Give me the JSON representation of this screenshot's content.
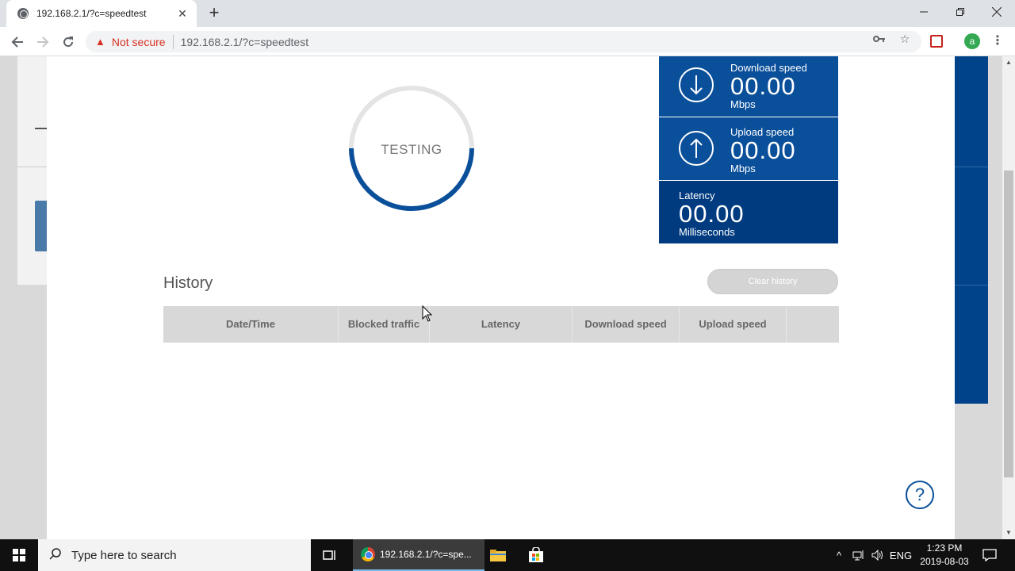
{
  "browser": {
    "tab_title": "192.168.2.1/?c=speedtest",
    "security_label": "Not secure",
    "url": "192.168.2.1/?c=speedtest",
    "profile_initial": "a"
  },
  "speedtest": {
    "status": "TESTING",
    "download": {
      "label": "Download speed",
      "value": "00.00",
      "unit": "Mbps"
    },
    "upload": {
      "label": "Upload speed",
      "value": "00.00",
      "unit": "Mbps"
    },
    "latency": {
      "label": "Latency",
      "value": "00.00",
      "unit": "Milliseconds"
    }
  },
  "history": {
    "title": "History",
    "clear_label": "Clear history",
    "columns": [
      "Date/Time",
      "Blocked traffic",
      "Latency",
      "Download speed",
      "Upload speed",
      ""
    ]
  },
  "help_label": "?",
  "taskbar": {
    "search_placeholder": "Type here to search",
    "chrome_label": "192.168.2.1/?c=spe...",
    "language": "ENG",
    "time": "1:23 PM",
    "date": "2019-08-03"
  },
  "colors": {
    "accent": "#0a4f9a",
    "accent_dark": "#003b80",
    "warning": "#d93025"
  }
}
